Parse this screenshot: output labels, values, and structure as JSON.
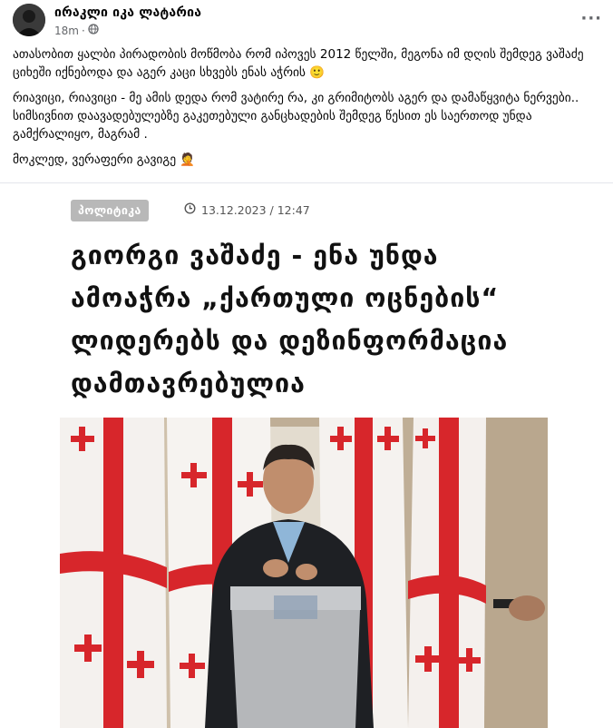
{
  "post": {
    "author_name": "ირაკლი იკა ლატარია",
    "time": "18m",
    "separator": "·",
    "audience_icon": "globe-icon",
    "more_label": "···",
    "paragraphs": [
      "ათასობით ყალბი პირადობის მოწმობა რომ იპოვეს 2012 წელში, მეგონა იმ დღის შემდეგ ვაშაძე ციხეში იქნებოდა და აგერ კაცი სხვებს ენას აჭრის 🙂",
      "რიავიცი, რიავიცი - მე ამის დედა რომ ვატირე რა, კი გრიმიტობს აგერ და დამაწყვიტა ნერვები.. სიმსივნით დაავადებულებზე გაკეთებული განცხადების შემდეგ წესით ეს საერთოდ უნდა გამქრალიყო, მაგრამ .",
      "მოკლედ, ვერაფერი გავიგე 🤦"
    ]
  },
  "article": {
    "category": "პოლიტიკა",
    "clock_icon": "clock-icon",
    "datetime": "13.12.2023 / 12:47",
    "headline": "გიორგი ვაშაძე - ენა უნდა ამოაჭრა „ქართული ოცნების“ ლიდერებს და დეზინფორმაცია დამთავრებულია",
    "photo_icon": "speaker-at-podium-with-flags-image"
  },
  "colors": {
    "flag_red": "#d7262b",
    "badge_gray": "#b8b8b8",
    "meta_gray": "#65676b"
  }
}
